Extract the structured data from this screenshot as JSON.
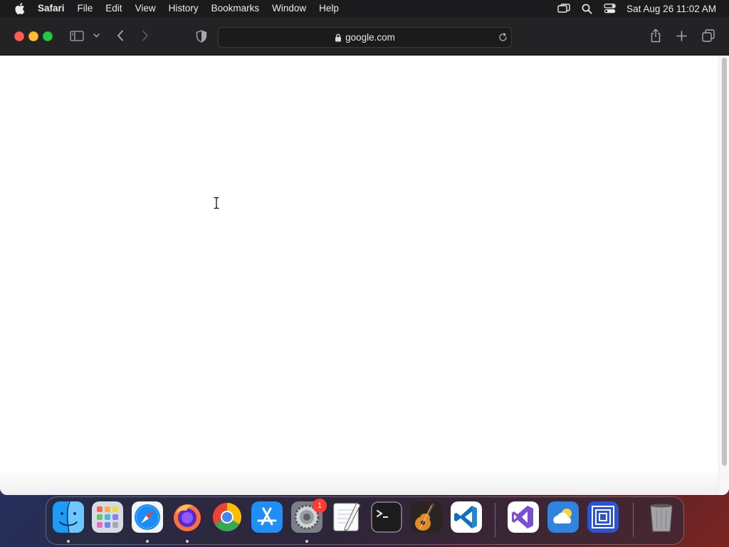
{
  "menubar": {
    "app_name": "Safari",
    "menus": [
      "File",
      "Edit",
      "View",
      "History",
      "Bookmarks",
      "Window",
      "Help"
    ],
    "clock": "Sat Aug 26  11:02 AM"
  },
  "browser": {
    "url": "google.com"
  },
  "dock": {
    "apps": [
      "Finder",
      "Launchpad",
      "Safari",
      "Firefox",
      "Chrome",
      "App Store",
      "System Settings",
      "TextEdit",
      "Terminal",
      "GarageBand",
      "Visual Studio Code",
      "Visual Studio",
      "Weather",
      "Screen Sharing",
      "Trash"
    ],
    "settings_badge": "1"
  },
  "colors": {
    "close": "#ff5f57",
    "minimize": "#febc2e",
    "maximize": "#28c840",
    "badge": "#ff3b30"
  }
}
